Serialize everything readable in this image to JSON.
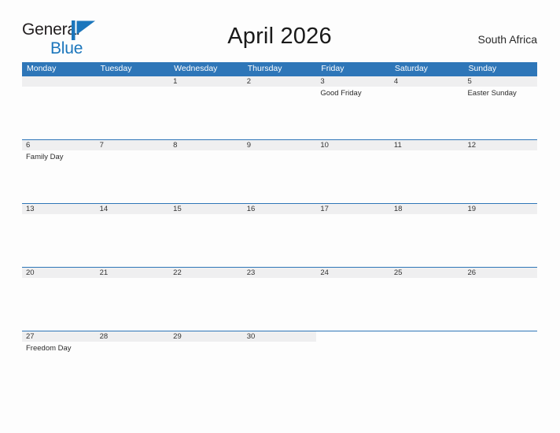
{
  "brand": {
    "name_part1": "General",
    "name_part2": "Blue",
    "mark_icon": "triangle-flag-icon",
    "color_dark": "#231f20",
    "color_blue": "#1b76bc"
  },
  "header": {
    "title": "April 2026",
    "region": "South Africa"
  },
  "theme": {
    "header_blue": "#2e76b8",
    "date_strip_gray": "#efeff0",
    "page_background": "#fdfdfd",
    "text_dark": "#333333"
  },
  "calendar": {
    "month": "April",
    "year": "2026",
    "week_start": "Monday",
    "weekdays": [
      {
        "label": "Monday"
      },
      {
        "label": "Tuesday"
      },
      {
        "label": "Wednesday"
      },
      {
        "label": "Thursday"
      },
      {
        "label": "Friday"
      },
      {
        "label": "Saturday"
      },
      {
        "label": "Sunday"
      }
    ],
    "weeks": [
      {
        "days": [
          {
            "date": "",
            "filled": true,
            "events": []
          },
          {
            "date": "",
            "filled": true,
            "events": []
          },
          {
            "date": "1",
            "filled": true,
            "events": []
          },
          {
            "date": "2",
            "filled": true,
            "events": []
          },
          {
            "date": "3",
            "filled": true,
            "events": [
              {
                "name": "Good Friday"
              }
            ]
          },
          {
            "date": "4",
            "filled": true,
            "events": []
          },
          {
            "date": "5",
            "filled": true,
            "events": [
              {
                "name": "Easter Sunday"
              }
            ]
          }
        ]
      },
      {
        "days": [
          {
            "date": "6",
            "filled": true,
            "events": [
              {
                "name": "Family Day"
              }
            ]
          },
          {
            "date": "7",
            "filled": true,
            "events": []
          },
          {
            "date": "8",
            "filled": true,
            "events": []
          },
          {
            "date": "9",
            "filled": true,
            "events": []
          },
          {
            "date": "10",
            "filled": true,
            "events": []
          },
          {
            "date": "11",
            "filled": true,
            "events": []
          },
          {
            "date": "12",
            "filled": true,
            "events": []
          }
        ]
      },
      {
        "days": [
          {
            "date": "13",
            "filled": true,
            "events": []
          },
          {
            "date": "14",
            "filled": true,
            "events": []
          },
          {
            "date": "15",
            "filled": true,
            "events": []
          },
          {
            "date": "16",
            "filled": true,
            "events": []
          },
          {
            "date": "17",
            "filled": true,
            "events": []
          },
          {
            "date": "18",
            "filled": true,
            "events": []
          },
          {
            "date": "19",
            "filled": true,
            "events": []
          }
        ]
      },
      {
        "days": [
          {
            "date": "20",
            "filled": true,
            "events": []
          },
          {
            "date": "21",
            "filled": true,
            "events": []
          },
          {
            "date": "22",
            "filled": true,
            "events": []
          },
          {
            "date": "23",
            "filled": true,
            "events": []
          },
          {
            "date": "24",
            "filled": true,
            "events": []
          },
          {
            "date": "25",
            "filled": true,
            "events": []
          },
          {
            "date": "26",
            "filled": true,
            "events": []
          }
        ]
      },
      {
        "days": [
          {
            "date": "27",
            "filled": true,
            "events": [
              {
                "name": "Freedom Day"
              }
            ]
          },
          {
            "date": "28",
            "filled": true,
            "events": []
          },
          {
            "date": "29",
            "filled": true,
            "events": []
          },
          {
            "date": "30",
            "filled": true,
            "events": []
          },
          {
            "date": "",
            "filled": false,
            "events": []
          },
          {
            "date": "",
            "filled": false,
            "events": []
          },
          {
            "date": "",
            "filled": false,
            "events": []
          }
        ]
      }
    ]
  }
}
